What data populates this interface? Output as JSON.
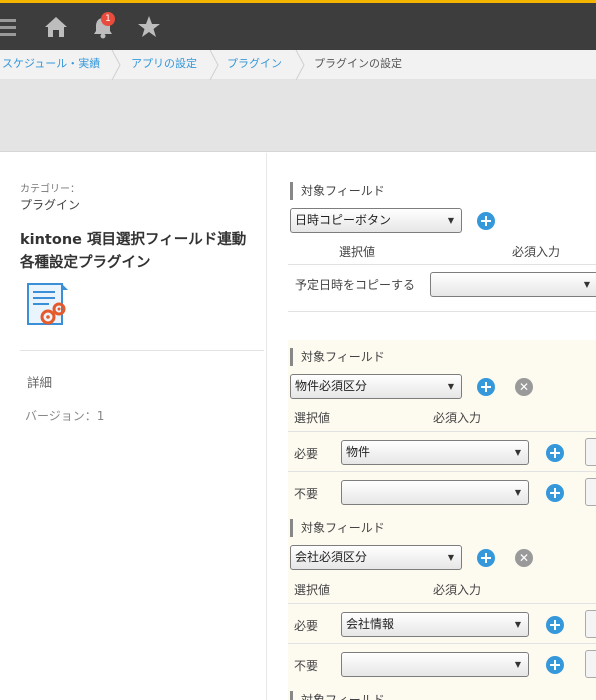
{
  "header": {
    "notification_count": "1",
    "icons": [
      "menu-icon",
      "home-icon",
      "bell-icon",
      "star-icon"
    ]
  },
  "breadcrumb": {
    "items": [
      "スケジュール・実績",
      "アプリの設定",
      "プラグイン",
      "プラグインの設定"
    ]
  },
  "sidebar": {
    "category_label": "カテゴリー：",
    "category_value": "プラグイン",
    "plugin_title": "kintone 項目選択フィールド連動各種設定プラグイン",
    "detail_link": "詳細",
    "version": "バージョン：1"
  },
  "settings": {
    "block1": {
      "heading": "対象フィールド",
      "field": "日時コピーボタン",
      "col_value": "選択値",
      "col_required": "必須入力",
      "row_label": "予定日時をコピーする",
      "row_select": ""
    },
    "block2": {
      "heading": "対象フィールド",
      "field": "物件必須区分",
      "col_value": "選択値",
      "col_required": "必須入力",
      "rows": [
        {
          "label": "必要",
          "select": "物件"
        },
        {
          "label": "不要",
          "select": ""
        }
      ]
    },
    "block3": {
      "heading": "対象フィールド",
      "field": "会社必須区分",
      "col_value": "選択値",
      "col_required": "必須入力",
      "rows": [
        {
          "label": "必要",
          "select": "会社情報"
        },
        {
          "label": "不要",
          "select": ""
        }
      ]
    },
    "block4": {
      "heading": "対象フィールド"
    }
  },
  "colors": {
    "accent": "#3498db",
    "header_bg": "#3d3d3d",
    "top_strip": "#f5b400",
    "badge": "#e74c3c"
  }
}
